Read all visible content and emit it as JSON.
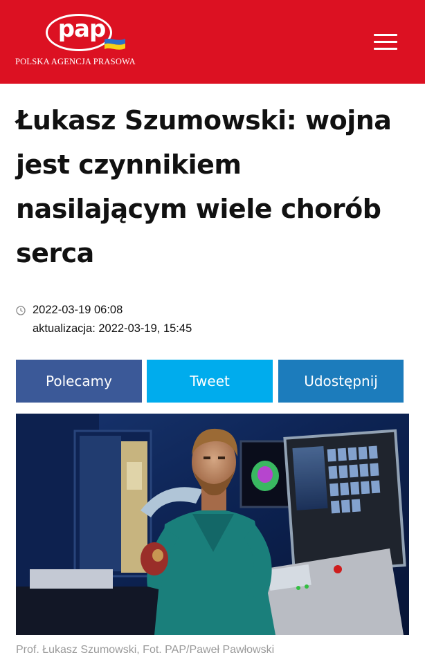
{
  "header": {
    "logo_text": "pap",
    "tagline": "POLSKA AGENCJA PRASOWA",
    "brand_color": "#dc1122",
    "menu_icon": "hamburger-menu-icon"
  },
  "article": {
    "title": "Łukasz Szumowski: wojna jest czynnikiem nasilającym wiele chorób serca",
    "date": "2022-03-19 06:08",
    "updated": "aktualizacja: 2022-03-19, 15:45",
    "date_icon": "clock-icon"
  },
  "share": {
    "recommend_label": "Polecamy",
    "tweet_label": "Tweet",
    "share_label": "Udostępnij",
    "colors": {
      "recommend": "#3b5998",
      "tweet": "#00aced",
      "share": "#1c7cbc"
    }
  },
  "photo": {
    "caption": "Prof. Łukasz Szumowski, Fot. PAP/Paweł Pawłowski"
  }
}
